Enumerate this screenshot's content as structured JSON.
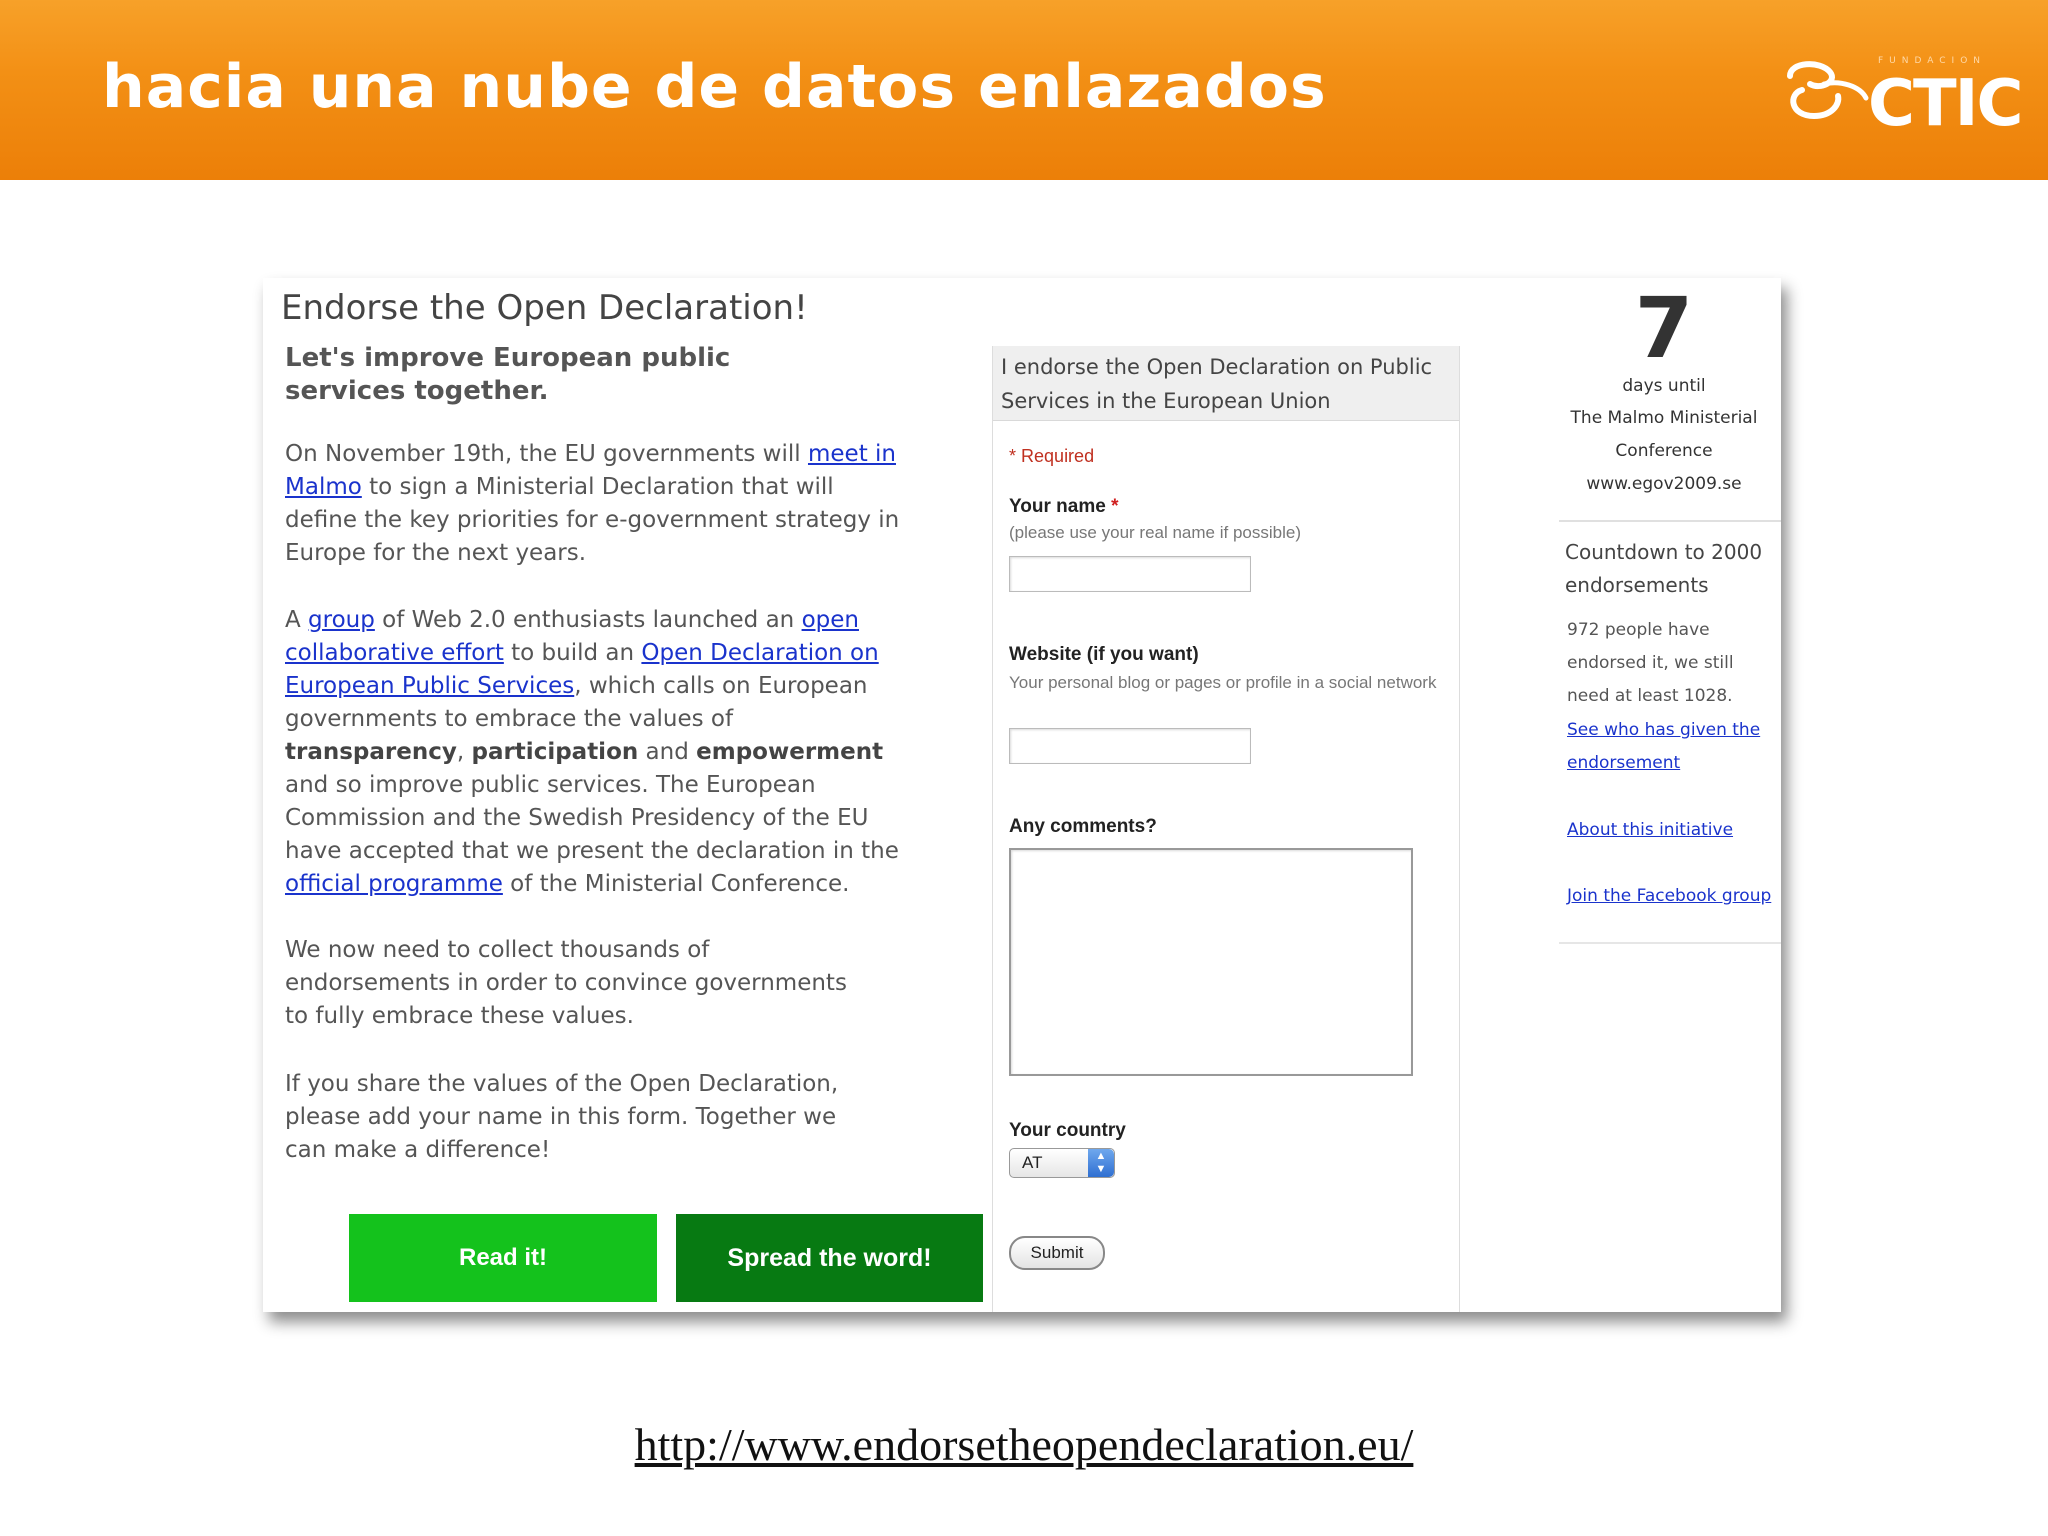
{
  "slide": {
    "title": "hacia una nube de datos enlazados",
    "logo": {
      "small_text": "FUNDACION",
      "brand": "CTIC"
    },
    "footer_url": "http://www.endorsetheopendeclaration.eu/"
  },
  "page": {
    "heading": "Endorse the Open Declaration!",
    "subheading": "Let's improve European public services together.",
    "para1": {
      "t1": "On November 19th, the EU governments will ",
      "link1": "meet in Malmo",
      "t2": " to sign a Ministerial Declaration that will define the key priorities for e-government strategy in Europe for the next years."
    },
    "para2": {
      "t1": "A ",
      "link1": "group",
      "t2": " of Web 2.0 enthusiasts launched an ",
      "link2": "open collaborative effort",
      "t3": " to build an ",
      "link3": "Open Declaration on European Public Services",
      "t4": ", which calls on European governments to embrace the values of ",
      "b1": "transparency",
      "t5": ", ",
      "b2": "participation",
      "t6": " and ",
      "b3": "empowerment",
      "t7": " and so improve public services. The European Commission and the Swedish Presidency of the EU have accepted that we present the declaration in the ",
      "link4": "official programme",
      "t8": " of the Ministerial Conference."
    },
    "para3": "We now need to collect thousands of endorsements in order to convince governments to fully embrace these values.",
    "para4": "If you share the values of the Open Declaration, please add your name in this form. Together we can make a difference!",
    "buttons": {
      "read": "Read it!",
      "spread": "Spread the word!"
    }
  },
  "form": {
    "header": "I endorse the Open Declaration on Public Services in the European Union",
    "required_star": "*",
    "required_note": "Required",
    "name_label": "Your name",
    "name_hint": "(please use your real name if possible)",
    "name_value": "",
    "website_label": "Website (if you want)",
    "website_hint": "Your personal blog or pages or profile in a social network",
    "website_value": "",
    "comments_label": "Any comments?",
    "comments_value": "",
    "country_label": "Your country",
    "country_value": "AT",
    "submit": "Submit"
  },
  "sidebar": {
    "days": "7",
    "days_until": "days until",
    "conf_line1": "The Malmo Ministerial",
    "conf_line2": "Conference",
    "site": "www.egov2009.se",
    "countdown_title": "Countdown to 2000 endorsements",
    "count_text": "972 people have endorsed it, we still need at least 1028.",
    "link_who": "See who has given the endorsement",
    "link_about": "About this initiative",
    "link_facebook": "Join the Facebook group"
  },
  "colors": {
    "banner": "#f39015",
    "read_button": "#14c21c",
    "spread_button": "#077a12",
    "link": "#1a33cc",
    "required": "#d02020"
  }
}
